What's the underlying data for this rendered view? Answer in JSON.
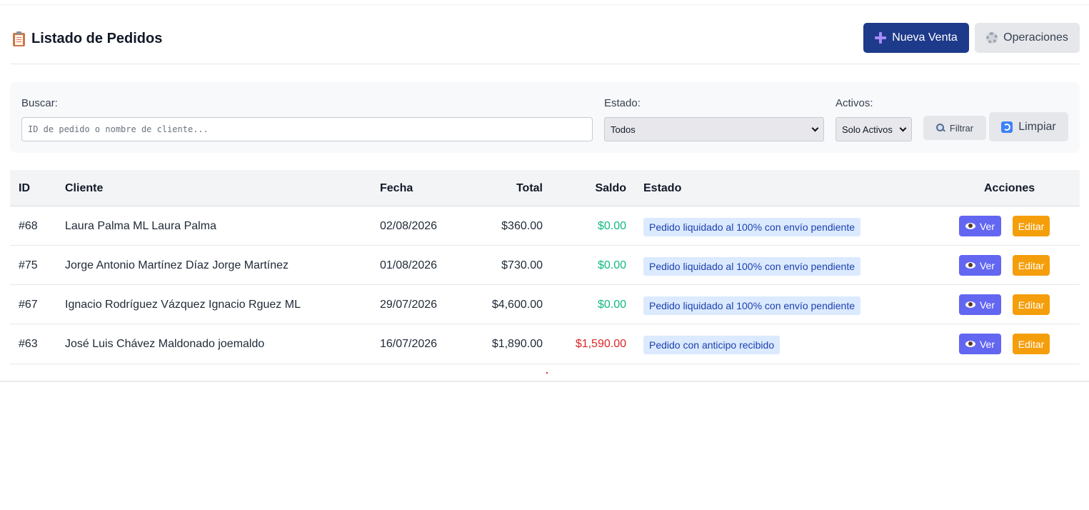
{
  "header": {
    "title": "Listado de Pedidos",
    "new_sale_label": "Nueva Venta",
    "operations_label": "Operaciones"
  },
  "filters": {
    "search_label": "Buscar:",
    "search_placeholder": "ID de pedido o nombre de cliente...",
    "search_value": "",
    "status_label": "Estado:",
    "status_selected": "Todos",
    "active_label": "Activos:",
    "active_selected": "Solo Activos",
    "filter_label": "Filtrar",
    "clear_label": "Limpiar"
  },
  "table": {
    "columns": {
      "id": "ID",
      "client": "Cliente",
      "date": "Fecha",
      "total": "Total",
      "balance": "Saldo",
      "status": "Estado",
      "actions": "Acciones"
    },
    "view_label": "Ver",
    "edit_label": "Editar",
    "rows": [
      {
        "id": "#68",
        "client": "Laura Palma ML Laura Palma",
        "date": "02/08/2026",
        "total": "$360.00",
        "balance": "$0.00",
        "status": "Pedido liquidado al 100% con envío pendiente"
      },
      {
        "id": "#75",
        "client": "Jorge Antonio Martínez Díaz Jorge Martínez",
        "date": "01/08/2026",
        "total": "$730.00",
        "balance": "$0.00",
        "status": "Pedido liquidado al 100% con envío pendiente"
      },
      {
        "id": "#67",
        "client": "Ignacio Rodríguez Vázquez Ignacio Rguez ML",
        "date": "29/07/2026",
        "total": "$4,600.00",
        "balance": "$0.00",
        "status": "Pedido liquidado al 100% con envío pendiente"
      },
      {
        "id": "#63",
        "client": "José Luis Chávez Maldonado joemaldo",
        "date": "16/07/2026",
        "total": "$1,890.00",
        "balance": "$1,590.00",
        "status": "Pedido con anticipo recibido"
      }
    ]
  },
  "colors": {
    "primary": "#1e3a8a",
    "view_button": "#6366f1",
    "edit_button": "#f59e0b",
    "balance_zero": "#10b981",
    "balance_due": "#dc2626",
    "badge_bg": "#dbeafe"
  }
}
